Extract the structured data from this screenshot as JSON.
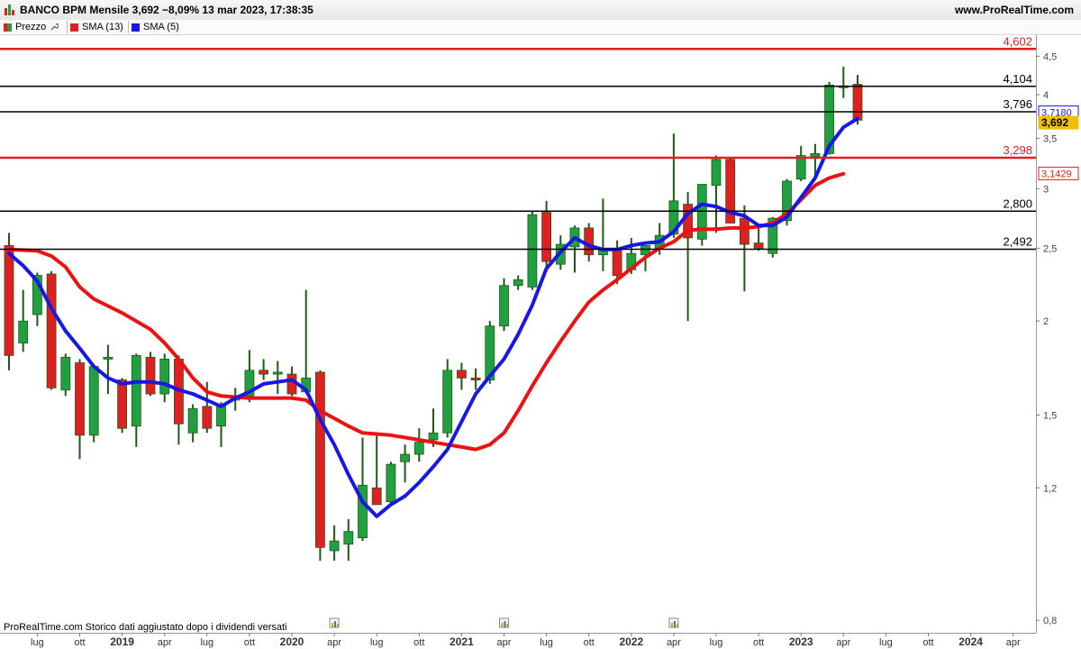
{
  "header": {
    "title": "BANCO BPM Mensile 3,692 −8,09% 13 mar 2023, 17:38:35",
    "site": "www.ProRealTime.com"
  },
  "legend": [
    {
      "label": "Prezzo",
      "color": "#20a040"
    },
    {
      "label": "SMA (13)",
      "color": "#e02020"
    },
    {
      "label": "SMA (5)",
      "color": "#1a1ae6"
    }
  ],
  "footer_note": "ProRealTime.com  Storico dati aggiustato dopo i dividendi versati",
  "chart_data": {
    "type": "candlestick",
    "y_scale": "log",
    "y_range": [
      0.77,
      4.8
    ],
    "y_ticks": [
      {
        "v": 0.8,
        "label": "0,8"
      },
      {
        "v": 1.2,
        "label": "1,2"
      },
      {
        "v": 1.5,
        "label": "1,5"
      },
      {
        "v": 2,
        "label": "2"
      },
      {
        "v": 2.5,
        "label": "2,5"
      },
      {
        "v": 3,
        "label": "3"
      },
      {
        "v": 3.5,
        "label": "3,5"
      },
      {
        "v": 4,
        "label": "4"
      },
      {
        "v": 4.5,
        "label": "4,5"
      }
    ],
    "x_ticks": [
      {
        "i": 2,
        "label": "lug",
        "bold": false
      },
      {
        "i": 5,
        "label": "ott",
        "bold": false
      },
      {
        "i": 8,
        "label": "2019",
        "bold": true
      },
      {
        "i": 11,
        "label": "apr",
        "bold": false
      },
      {
        "i": 14,
        "label": "lug",
        "bold": false
      },
      {
        "i": 17,
        "label": "ott",
        "bold": false
      },
      {
        "i": 20,
        "label": "2020",
        "bold": true
      },
      {
        "i": 23,
        "label": "apr",
        "bold": false
      },
      {
        "i": 26,
        "label": "lug",
        "bold": false
      },
      {
        "i": 29,
        "label": "ott",
        "bold": false
      },
      {
        "i": 32,
        "label": "2021",
        "bold": true
      },
      {
        "i": 35,
        "label": "apr",
        "bold": false
      },
      {
        "i": 38,
        "label": "lug",
        "bold": false
      },
      {
        "i": 41,
        "label": "ott",
        "bold": false
      },
      {
        "i": 44,
        "label": "2022",
        "bold": true
      },
      {
        "i": 47,
        "label": "apr",
        "bold": false
      },
      {
        "i": 50,
        "label": "lug",
        "bold": false
      },
      {
        "i": 53,
        "label": "ott",
        "bold": false
      },
      {
        "i": 56,
        "label": "2023",
        "bold": true
      },
      {
        "i": 59,
        "label": "apr",
        "bold": false
      },
      {
        "i": 62,
        "label": "lug",
        "bold": false
      },
      {
        "i": 65,
        "label": "ott",
        "bold": false
      },
      {
        "i": 68,
        "label": "2024",
        "bold": true
      },
      {
        "i": 71,
        "label": "apr",
        "bold": false
      }
    ],
    "candles": [
      {
        "o": 2.52,
        "h": 2.62,
        "l": 1.72,
        "c": 1.8
      },
      {
        "o": 1.87,
        "h": 2.2,
        "l": 1.82,
        "c": 2.0
      },
      {
        "o": 2.04,
        "h": 2.32,
        "l": 1.97,
        "c": 2.3
      },
      {
        "o": 2.31,
        "h": 2.33,
        "l": 1.62,
        "c": 1.63
      },
      {
        "o": 1.62,
        "h": 1.81,
        "l": 1.59,
        "c": 1.79
      },
      {
        "o": 1.76,
        "h": 1.78,
        "l": 1.31,
        "c": 1.41
      },
      {
        "o": 1.41,
        "h": 1.75,
        "l": 1.38,
        "c": 1.74
      },
      {
        "o": 1.78,
        "h": 1.86,
        "l": 1.6,
        "c": 1.79
      },
      {
        "o": 1.67,
        "h": 1.68,
        "l": 1.42,
        "c": 1.44
      },
      {
        "o": 1.45,
        "h": 1.81,
        "l": 1.36,
        "c": 1.8
      },
      {
        "o": 1.79,
        "h": 1.82,
        "l": 1.59,
        "c": 1.6
      },
      {
        "o": 1.6,
        "h": 1.81,
        "l": 1.56,
        "c": 1.78
      },
      {
        "o": 1.78,
        "h": 1.8,
        "l": 1.37,
        "c": 1.46
      },
      {
        "o": 1.42,
        "h": 1.55,
        "l": 1.38,
        "c": 1.53
      },
      {
        "o": 1.54,
        "h": 1.66,
        "l": 1.42,
        "c": 1.44
      },
      {
        "o": 1.45,
        "h": 1.56,
        "l": 1.36,
        "c": 1.55
      },
      {
        "o": 1.57,
        "h": 1.63,
        "l": 1.52,
        "c": 1.58
      },
      {
        "o": 1.59,
        "h": 1.83,
        "l": 1.56,
        "c": 1.72
      },
      {
        "o": 1.72,
        "h": 1.78,
        "l": 1.67,
        "c": 1.7
      },
      {
        "o": 1.7,
        "h": 1.77,
        "l": 1.6,
        "c": 1.71
      },
      {
        "o": 1.7,
        "h": 1.74,
        "l": 1.59,
        "c": 1.6
      },
      {
        "o": 1.61,
        "h": 2.2,
        "l": 1.6,
        "c": 1.68
      },
      {
        "o": 1.71,
        "h": 1.72,
        "l": 0.96,
        "c": 1.0
      },
      {
        "o": 0.99,
        "h": 1.07,
        "l": 0.96,
        "c": 1.02
      },
      {
        "o": 1.01,
        "h": 1.09,
        "l": 0.96,
        "c": 1.05
      },
      {
        "o": 1.03,
        "h": 1.4,
        "l": 1.02,
        "c": 1.21
      },
      {
        "o": 1.2,
        "h": 1.42,
        "l": 1.17,
        "c": 1.14
      },
      {
        "o": 1.15,
        "h": 1.3,
        "l": 1.14,
        "c": 1.29
      },
      {
        "o": 1.3,
        "h": 1.37,
        "l": 1.22,
        "c": 1.33
      },
      {
        "o": 1.33,
        "h": 1.44,
        "l": 1.3,
        "c": 1.38
      },
      {
        "o": 1.39,
        "h": 1.53,
        "l": 1.36,
        "c": 1.42
      },
      {
        "o": 1.42,
        "h": 1.78,
        "l": 1.4,
        "c": 1.72
      },
      {
        "o": 1.72,
        "h": 1.76,
        "l": 1.62,
        "c": 1.68
      },
      {
        "o": 1.68,
        "h": 1.73,
        "l": 1.62,
        "c": 1.67
      },
      {
        "o": 1.67,
        "h": 2.0,
        "l": 1.65,
        "c": 1.97
      },
      {
        "o": 1.97,
        "h": 2.28,
        "l": 1.94,
        "c": 2.23
      },
      {
        "o": 2.23,
        "h": 2.3,
        "l": 2.2,
        "c": 2.27
      },
      {
        "o": 2.22,
        "h": 2.8,
        "l": 2.2,
        "c": 2.77
      },
      {
        "o": 2.79,
        "h": 2.89,
        "l": 2.36,
        "c": 2.4
      },
      {
        "o": 2.38,
        "h": 2.6,
        "l": 2.34,
        "c": 2.53
      },
      {
        "o": 2.51,
        "h": 2.68,
        "l": 2.32,
        "c": 2.66
      },
      {
        "o": 2.66,
        "h": 2.7,
        "l": 2.4,
        "c": 2.45
      },
      {
        "o": 2.45,
        "h": 2.91,
        "l": 2.33,
        "c": 2.49
      },
      {
        "o": 2.49,
        "h": 2.56,
        "l": 2.24,
        "c": 2.3
      },
      {
        "o": 2.34,
        "h": 2.58,
        "l": 2.31,
        "c": 2.46
      },
      {
        "o": 2.45,
        "h": 2.52,
        "l": 2.33,
        "c": 2.52
      },
      {
        "o": 2.5,
        "h": 2.7,
        "l": 2.45,
        "c": 2.6
      },
      {
        "o": 2.61,
        "h": 3.55,
        "l": 2.58,
        "c": 2.89
      },
      {
        "o": 2.86,
        "h": 2.97,
        "l": 2.0,
        "c": 2.58
      },
      {
        "o": 2.57,
        "h": 3.04,
        "l": 2.52,
        "c": 3.04
      },
      {
        "o": 3.03,
        "h": 3.32,
        "l": 2.62,
        "c": 3.28
      },
      {
        "o": 3.28,
        "h": 3.3,
        "l": 2.85,
        "c": 2.7
      },
      {
        "o": 2.74,
        "h": 2.85,
        "l": 2.19,
        "c": 2.53
      },
      {
        "o": 2.54,
        "h": 2.69,
        "l": 2.48,
        "c": 2.5
      },
      {
        "o": 2.46,
        "h": 2.75,
        "l": 2.43,
        "c": 2.74
      },
      {
        "o": 2.72,
        "h": 3.09,
        "l": 2.68,
        "c": 3.07
      },
      {
        "o": 3.09,
        "h": 3.42,
        "l": 3.07,
        "c": 3.32
      },
      {
        "o": 3.31,
        "h": 3.44,
        "l": 3.09,
        "c": 3.34
      },
      {
        "o": 3.34,
        "h": 4.16,
        "l": 3.33,
        "c": 4.12
      },
      {
        "o": 4.11,
        "h": 4.36,
        "l": 3.96,
        "c": 4.1
      },
      {
        "o": 4.13,
        "h": 4.25,
        "l": 3.65,
        "c": 3.7
      }
    ],
    "sma13": [
      [
        0,
        2.49
      ],
      [
        2,
        2.48
      ],
      [
        3,
        2.44
      ],
      [
        4,
        2.36
      ],
      [
        5,
        2.22
      ],
      [
        6,
        2.14
      ],
      [
        8,
        2.05
      ],
      [
        10,
        1.95
      ],
      [
        11,
        1.87
      ],
      [
        12,
        1.78
      ],
      [
        13,
        1.68
      ],
      [
        14,
        1.61
      ],
      [
        15,
        1.59
      ],
      [
        17,
        1.58
      ],
      [
        19,
        1.58
      ],
      [
        20,
        1.58
      ],
      [
        21,
        1.57
      ],
      [
        22,
        1.52
      ],
      [
        24,
        1.45
      ],
      [
        25,
        1.42
      ],
      [
        27,
        1.41
      ],
      [
        28,
        1.4
      ],
      [
        29,
        1.39
      ],
      [
        31,
        1.37
      ],
      [
        32,
        1.36
      ],
      [
        33,
        1.35
      ],
      [
        34,
        1.37
      ],
      [
        35,
        1.42
      ],
      [
        36,
        1.52
      ],
      [
        37,
        1.64
      ],
      [
        38,
        1.76
      ],
      [
        39,
        1.88
      ],
      [
        40,
        2.0
      ],
      [
        41,
        2.12
      ],
      [
        42,
        2.2
      ],
      [
        43,
        2.27
      ],
      [
        44,
        2.35
      ],
      [
        45,
        2.43
      ],
      [
        46,
        2.5
      ],
      [
        47,
        2.55
      ],
      [
        48,
        2.64
      ],
      [
        49,
        2.65
      ],
      [
        50,
        2.65
      ],
      [
        51,
        2.66
      ],
      [
        52,
        2.66
      ],
      [
        53,
        2.67
      ],
      [
        54,
        2.7
      ],
      [
        55,
        2.78
      ],
      [
        56,
        2.9
      ],
      [
        57,
        3.03
      ],
      [
        58,
        3.1
      ],
      [
        59,
        3.14
      ]
    ],
    "sma5": [
      [
        0,
        2.46
      ],
      [
        1,
        2.37
      ],
      [
        2,
        2.26
      ],
      [
        3,
        2.08
      ],
      [
        4,
        1.94
      ],
      [
        5,
        1.84
      ],
      [
        6,
        1.74
      ],
      [
        7,
        1.68
      ],
      [
        8,
        1.65
      ],
      [
        9,
        1.66
      ],
      [
        10,
        1.66
      ],
      [
        11,
        1.65
      ],
      [
        12,
        1.62
      ],
      [
        13,
        1.6
      ],
      [
        14,
        1.57
      ],
      [
        15,
        1.54
      ],
      [
        16,
        1.58
      ],
      [
        17,
        1.61
      ],
      [
        18,
        1.65
      ],
      [
        19,
        1.66
      ],
      [
        20,
        1.67
      ],
      [
        21,
        1.62
      ],
      [
        22,
        1.48
      ],
      [
        23,
        1.37
      ],
      [
        24,
        1.25
      ],
      [
        25,
        1.15
      ],
      [
        26,
        1.1
      ],
      [
        27,
        1.14
      ],
      [
        28,
        1.17
      ],
      [
        29,
        1.22
      ],
      [
        30,
        1.28
      ],
      [
        31,
        1.35
      ],
      [
        32,
        1.47
      ],
      [
        33,
        1.6
      ],
      [
        34,
        1.69
      ],
      [
        35,
        1.78
      ],
      [
        36,
        1.92
      ],
      [
        37,
        2.1
      ],
      [
        38,
        2.35
      ],
      [
        39,
        2.47
      ],
      [
        40,
        2.58
      ],
      [
        41,
        2.52
      ],
      [
        42,
        2.49
      ],
      [
        43,
        2.49
      ],
      [
        44,
        2.52
      ],
      [
        45,
        2.54
      ],
      [
        46,
        2.55
      ],
      [
        47,
        2.63
      ],
      [
        48,
        2.78
      ],
      [
        49,
        2.86
      ],
      [
        50,
        2.84
      ],
      [
        51,
        2.79
      ],
      [
        52,
        2.76
      ],
      [
        53,
        2.68
      ],
      [
        54,
        2.68
      ],
      [
        55,
        2.75
      ],
      [
        56,
        2.92
      ],
      [
        57,
        3.1
      ],
      [
        58,
        3.42
      ],
      [
        59,
        3.62
      ],
      [
        60,
        3.718
      ]
    ],
    "hlines": [
      {
        "v": 4.602,
        "label": "4,602",
        "color": "#e02020",
        "width": 2.5
      },
      {
        "v": 4.104,
        "label": "4,104",
        "color": "#000000",
        "width": 1.5
      },
      {
        "v": 3.796,
        "label": "3,796",
        "color": "#000000",
        "width": 1.5
      },
      {
        "v": 3.298,
        "label": "3,298",
        "color": "#e02020",
        "width": 2.5
      },
      {
        "v": 2.8,
        "label": "2,800",
        "color": "#000000",
        "width": 1.5
      },
      {
        "v": 2.492,
        "label": "2,492",
        "color": "#000000",
        "width": 1.5
      }
    ],
    "tags": [
      {
        "v": 3.718,
        "label": "3,7180",
        "style": "blue"
      },
      {
        "v": 3.692,
        "label": "3,692",
        "style": "price"
      },
      {
        "v": 3.1429,
        "label": "3,1429",
        "style": "red"
      }
    ],
    "event_markers": [
      23,
      35,
      47
    ],
    "colors": {
      "up": "#20a040",
      "down": "#e02020",
      "wick": "#1e5a14",
      "sma13": "#ee1111",
      "sma5": "#1818e6",
      "price_tag": "#f0c000"
    }
  }
}
